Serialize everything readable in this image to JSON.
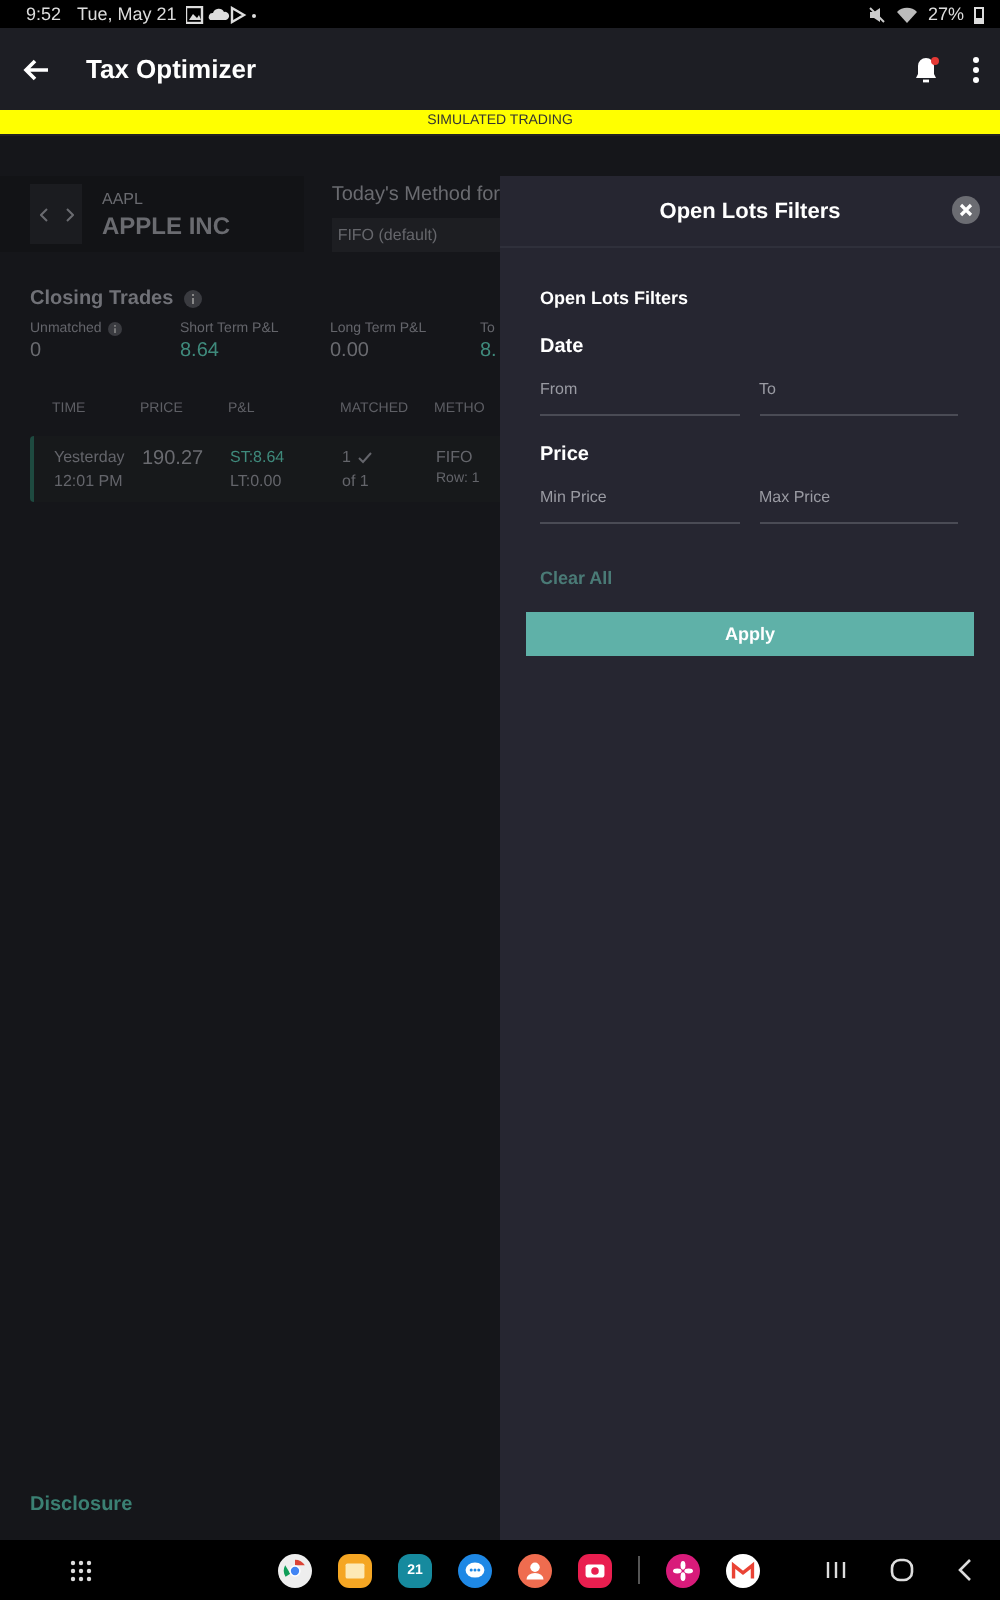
{
  "status_bar": {
    "time": "9:52",
    "date": "Tue, May 21",
    "battery": "27%"
  },
  "app_bar": {
    "title": "Tax Optimizer",
    "notification": true
  },
  "banner": "SIMULATED TRADING",
  "ticker": {
    "symbol": "AAPL",
    "name": "APPLE INC",
    "method_label": "Today's Method for",
    "method_value": "FIFO (default)"
  },
  "closing_trades": {
    "title": "Closing Trades",
    "stats": [
      {
        "label": "Unmatched",
        "value": "0",
        "info": true,
        "positive": false
      },
      {
        "label": "Short Term P&L",
        "value": "8.64",
        "info": false,
        "positive": true
      },
      {
        "label": "Long Term P&L",
        "value": "0.00",
        "info": false,
        "positive": false
      },
      {
        "label": "To",
        "value": "8.",
        "info": false,
        "positive": true
      }
    ],
    "columns": [
      "TIME",
      "PRICE",
      "P&L",
      "MATCHED",
      "METHO"
    ],
    "rows": [
      {
        "time": "Yesterday",
        "time2": "12:01 PM",
        "price": "190.27",
        "st": "ST:8.64",
        "lt": "LT:0.00",
        "matched": "1",
        "matched2": "of 1",
        "method": "FIFO",
        "row": "Row: 1"
      }
    ]
  },
  "disclosure": "Disclosure",
  "panel": {
    "title": "Open Lots Filters",
    "subtitle": "Open Lots Filters",
    "sections": [
      {
        "title": "Date",
        "fields": [
          {
            "label": "From"
          },
          {
            "label": "To"
          }
        ]
      },
      {
        "title": "Price",
        "fields": [
          {
            "label": "Min Price"
          },
          {
            "label": "Max Price"
          }
        ]
      }
    ],
    "clear": {
      "label": "Clear All",
      "disabled": true
    },
    "apply": "Apply"
  },
  "dock": [
    {
      "kind": "chrome"
    },
    {
      "kind": "files"
    },
    {
      "kind": "calendar",
      "label": "21"
    },
    {
      "kind": "messages"
    },
    {
      "kind": "contacts"
    },
    {
      "kind": "camera"
    },
    {
      "kind": "divider"
    },
    {
      "kind": "flower"
    },
    {
      "kind": "gmail"
    }
  ]
}
